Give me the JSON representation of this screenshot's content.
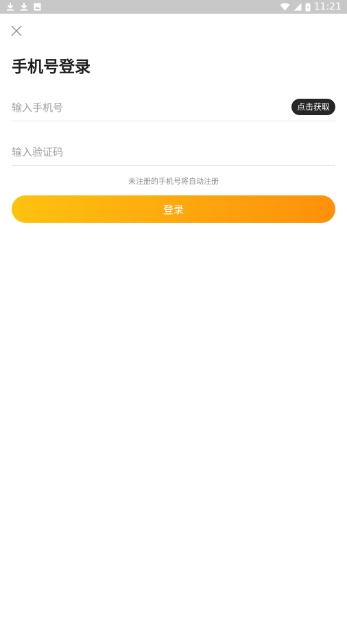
{
  "status_bar": {
    "time": "11:21",
    "left_icons": [
      "download-icon",
      "download-icon",
      "image-icon"
    ],
    "right_icons": [
      "wifi-icon",
      "signal-icon",
      "battery-icon"
    ]
  },
  "header": {
    "close_icon": "close-icon",
    "title": "手机号登录"
  },
  "form": {
    "phone_placeholder": "输入手机号",
    "get_code_label": "点击获取",
    "code_placeholder": "输入验证码",
    "hint": "未注册的手机号将自动注册",
    "login_label": "登录"
  },
  "colors": {
    "status_bar_bg": "#c8c8c8",
    "title": "#1f1f1f",
    "get_code_bg": "#262626",
    "login_gradient_start": "#fec20f",
    "login_gradient_end": "#ff900a",
    "placeholder": "#9e9e9e",
    "hint": "#8c8c8c"
  }
}
